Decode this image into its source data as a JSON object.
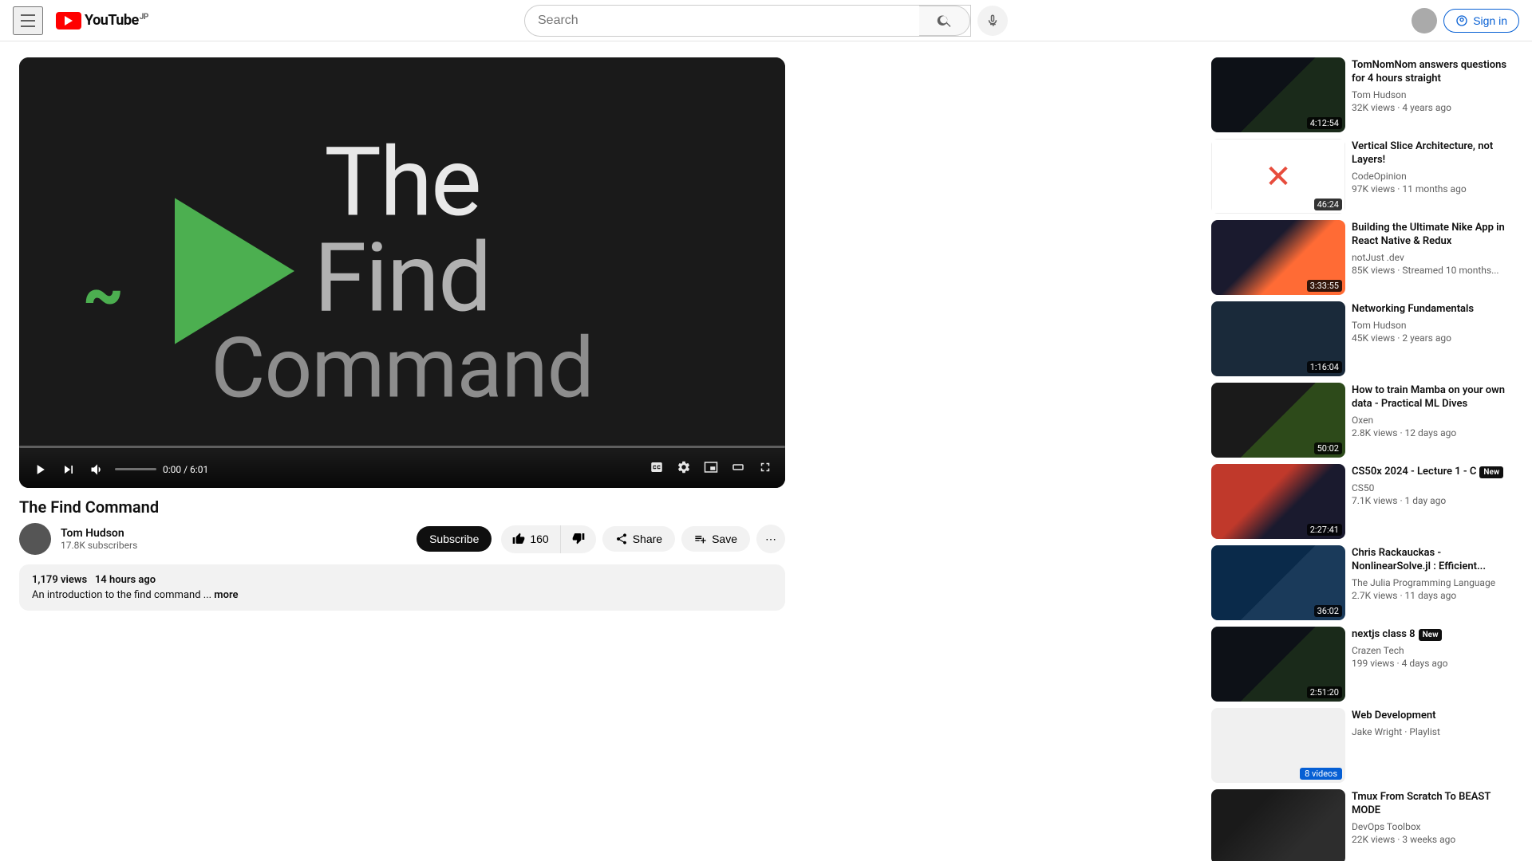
{
  "header": {
    "logo_text": "YouTube",
    "logo_country": "JP",
    "search_placeholder": "Search",
    "sign_in_label": "Sign in"
  },
  "video": {
    "title": "The Find Command",
    "overlay_line1": "The",
    "overlay_line2": "Find",
    "overlay_line3": "Command",
    "time_current": "0:00",
    "time_total": "6:01",
    "views": "1,179 views",
    "time_ago": "14 hours ago",
    "description": "An introduction to the find command ...",
    "description_more": "more",
    "like_count": "160"
  },
  "channel": {
    "name": "Tom Hudson",
    "subscribers": "17.8K subscribers",
    "subscribe_label": "Subscribe"
  },
  "buttons": {
    "share": "Share",
    "save": "Save"
  },
  "sidebar": {
    "items": [
      {
        "title": "TomNomNom answers questions for 4 hours straight",
        "channel": "Tom Hudson",
        "meta": "32K views · 4 years ago",
        "duration": "4:12:54",
        "thumb_class": "thumb-1"
      },
      {
        "title": "Vertical Slice Architecture, not Layers!",
        "channel": "CodeOpinion",
        "meta": "97K views · 11 months ago",
        "duration": "46:24",
        "thumb_class": "thumb-2",
        "has_cross": true
      },
      {
        "title": "Building the Ultimate Nike App in React Native & Redux",
        "channel": "notJust .dev",
        "meta": "85K views · Streamed 10 months...",
        "duration": "3:33:55",
        "thumb_class": "thumb-3"
      },
      {
        "title": "Networking Fundamentals",
        "channel": "Tom Hudson",
        "meta": "45K views · 2 years ago",
        "duration": "1:16:04",
        "thumb_class": "thumb-4"
      },
      {
        "title": "How to train Mamba on your own data - Practical ML Dives",
        "channel": "Oxen",
        "meta": "2.8K views · 12 days ago",
        "duration": "50:02",
        "thumb_class": "thumb-5"
      },
      {
        "title": "CS50x 2024 - Lecture 1 - C",
        "channel": "CS50",
        "meta": "7.1K views · 1 day ago",
        "duration": "2:27:41",
        "thumb_class": "thumb-6",
        "badge": "New"
      },
      {
        "title": "Chris Rackauckas - NonlinearSolve.jl : Efficient...",
        "channel": "The Julia Programming Language",
        "meta": "2.7K views · 11 days ago",
        "duration": "36:02",
        "thumb_class": "thumb-7"
      },
      {
        "title": "nextjs class 8",
        "channel": "Crazen Tech",
        "meta": "199 views · 4 days ago",
        "duration": "2:51:20",
        "thumb_class": "thumb-1",
        "badge": "New"
      },
      {
        "title": "Web Development",
        "channel": "Jake Wright · Playlist",
        "meta": "",
        "duration": "",
        "thumb_class": "thumb-8",
        "playlist_badge": "8 videos"
      },
      {
        "title": "Tmux From Scratch To BEAST MODE",
        "channel": "DevOps Toolbox",
        "meta": "22K views · 3 weeks ago",
        "duration": "",
        "thumb_class": "thumb-9"
      }
    ]
  }
}
